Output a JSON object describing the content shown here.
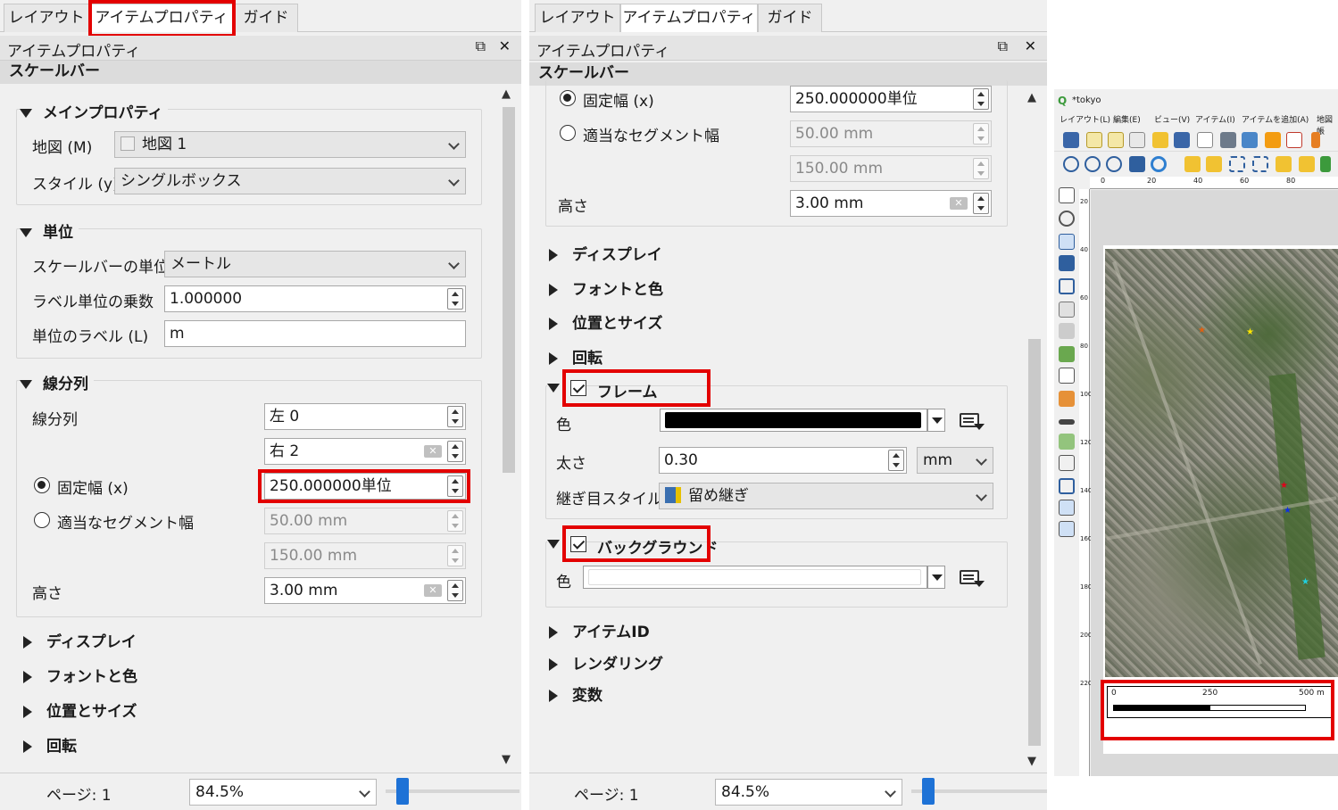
{
  "tabs": [
    "レイアウト",
    "アイテムプロパティ",
    "ガイド"
  ],
  "dock_title": "アイテムプロパティ",
  "section_title": "スケールバー",
  "main_props": {
    "header": "メインプロパティ",
    "map_label": "地図 (M)",
    "map_value": "地図 1",
    "style_label": "スタイル (y)",
    "style_value": "シングルボックス"
  },
  "units": {
    "header": "単位",
    "unit_label": "スケールバーの単位",
    "unit_value": "メートル",
    "multiplier_label": "ラベル単位の乗数",
    "multiplier_value": "1.000000",
    "label_label": "単位のラベル (L)",
    "label_value": "m"
  },
  "segments": {
    "header": "線分列",
    "segments_label": "線分列",
    "left_value": "左 0",
    "right_value": "右 2",
    "fixed_label": "固定幅 (x)",
    "fixed_value": "250.000000単位",
    "fit_label": "適当なセグメント幅",
    "fit_min": "50.00 mm",
    "fit_max": "150.00 mm",
    "height_label": "高さ",
    "height_value": "3.00 mm"
  },
  "collapsed_sections": [
    "ディスプレイ",
    "フォントと色",
    "位置とサイズ",
    "回転"
  ],
  "frame": {
    "label": "フレーム",
    "color_label": "色",
    "color": "#000000",
    "width_label": "太さ",
    "width_value": "0.30",
    "width_unit": "mm",
    "join_label": "継ぎ目スタイル",
    "join_value": "留め継ぎ"
  },
  "background": {
    "label": "バックグラウンド",
    "color_label": "色",
    "color": "#ffffff"
  },
  "more_sections": [
    "アイテムID",
    "レンダリング",
    "変数"
  ],
  "status": {
    "page_label": "ページ: 1",
    "zoom_value": "84.5%"
  },
  "qgis": {
    "title": "*tokyo",
    "menus": [
      "レイアウト(L)",
      "編集(E)",
      "ビュー(V)",
      "アイテム(I)",
      "アイテムを追加(A)",
      "地図帳"
    ],
    "ruler_top": [
      "0",
      "20",
      "40",
      "60",
      "80"
    ],
    "ruler_left": [
      "20",
      "40",
      "60",
      "80",
      "100",
      "120",
      "140",
      "160",
      "180",
      "200",
      "220"
    ],
    "scalebar_labels": [
      "0",
      "250",
      "500 m"
    ]
  },
  "colors": {
    "highlight": "#e30000",
    "accent": "#1e72d6"
  }
}
